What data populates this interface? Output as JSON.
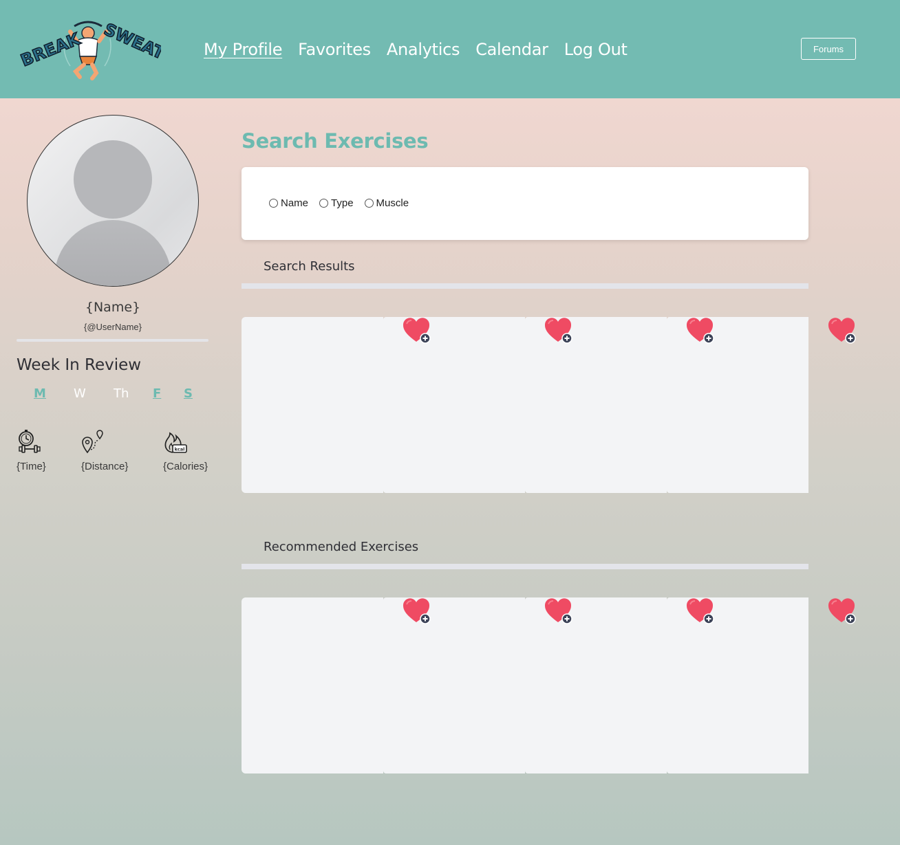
{
  "header": {
    "logo_text": "BREAK SWEAT",
    "nav": [
      {
        "label": "My Profile",
        "active": true
      },
      {
        "label": "Favorites",
        "active": false
      },
      {
        "label": "Analytics",
        "active": false
      },
      {
        "label": "Calendar",
        "active": false
      },
      {
        "label": "Log Out",
        "active": false
      }
    ],
    "forums_label": "Forums",
    "bg_color": "#73bbb2"
  },
  "profile": {
    "name": "{Name}",
    "username": "{@UserName}"
  },
  "week": {
    "title": "Week In Review",
    "days": [
      {
        "label": "M",
        "active": true
      },
      {
        "label": "W",
        "active": false
      },
      {
        "label": "Th",
        "active": false
      },
      {
        "label": "F",
        "active": true
      },
      {
        "label": "S",
        "active": true
      }
    ],
    "stats": [
      {
        "icon": "stopwatch-dumbbell-icon",
        "label": "{Time}"
      },
      {
        "icon": "map-pin-route-icon",
        "label": "{Distance}"
      },
      {
        "icon": "flame-kcal-icon",
        "label": "{Calories}"
      }
    ]
  },
  "search": {
    "title": "Search Exercises",
    "options": [
      "Name",
      "Type",
      "Muscle"
    ],
    "results_label": "Search Results"
  },
  "recommended": {
    "label": "Recommended Exercises"
  },
  "colors": {
    "accent": "#6dbab0",
    "heart": "#ef4b63",
    "tile": "#f3f4f6"
  }
}
